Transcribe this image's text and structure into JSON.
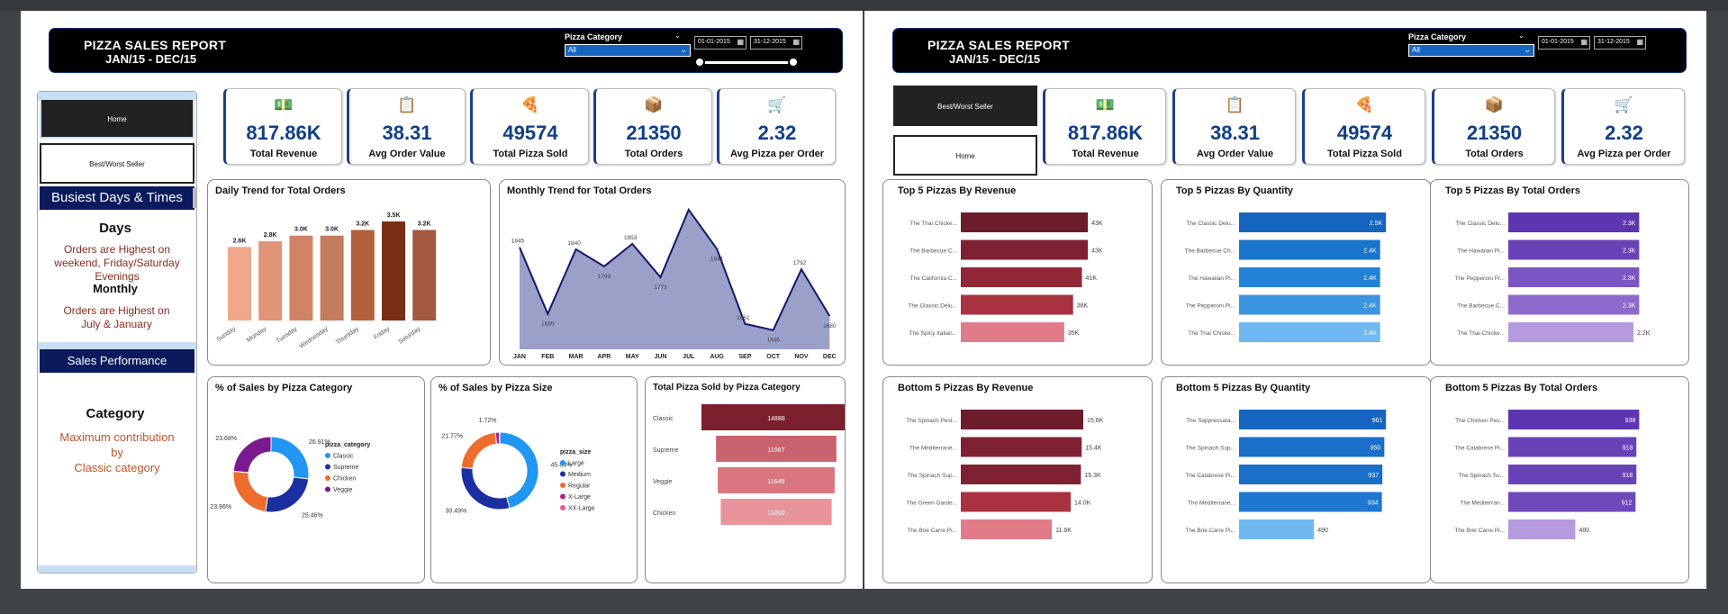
{
  "report": {
    "title": "PIZZA SALES REPORT",
    "subtitle": "JAN/15 - DEC/15"
  },
  "filters": {
    "category_label": "Pizza Category",
    "category_value": "All",
    "date_from": "01-01-2015",
    "date_to": "31-12-2015"
  },
  "nav": {
    "home": "Home",
    "best_worst": "Best/Worst Seller"
  },
  "kpis": [
    {
      "value": "817.86K",
      "label": "Total Revenue",
      "icon": "money-icon"
    },
    {
      "value": "38.31",
      "label": "Avg Order Value",
      "icon": "receipt-icon"
    },
    {
      "value": "49574",
      "label": "Total Pizza Sold",
      "icon": "pizza-icon"
    },
    {
      "value": "21350",
      "label": "Total Orders",
      "icon": "orders-icon"
    },
    {
      "value": "2.32",
      "label": "Avg Pizza per Order",
      "icon": "cart-icon"
    }
  ],
  "insights": {
    "busiest_title": "Busiest Days & Times",
    "days_head": "Days",
    "days_text": "Orders are Highest on weekend, Friday/Saturday Evenings",
    "monthly_head": "Monthly",
    "monthly_text": "Orders are Highest on July & January",
    "sales_perf": "Sales Performance",
    "category_head": "Category",
    "category_text_1": "Maximum contribution",
    "category_text_2": "by",
    "category_text_3": "Classic category"
  },
  "chart_titles": {
    "daily": "Daily Trend for Total Orders",
    "monthly": "Monthly Trend for Total Orders",
    "cat_pct": "% of Sales by Pizza Category",
    "size_pct": "% of Sales by Pizza Size",
    "cat_total": "Total Pizza Sold by Pizza Category",
    "top_rev": "Top 5 Pizzas By Revenue",
    "top_qty": "Top 5 Pizzas By Quantity",
    "top_ord": "Top 5 Pizzas By Total Orders",
    "bot_rev": "Bottom 5 Pizzas By Revenue",
    "bot_qty": "Bottom 5 Pizzas By Quantity",
    "bot_ord": "Bottom 5 Pizzas By Total Orders"
  },
  "chart_data": [
    {
      "id": "daily",
      "type": "bar",
      "categories": [
        "Sunday",
        "Monday",
        "Tuesday",
        "Wednesday",
        "Thursday",
        "Friday",
        "Saturday"
      ],
      "values": [
        2.6,
        2.8,
        3.0,
        3.0,
        3.2,
        3.5,
        3.2
      ],
      "labels": [
        "2.6K",
        "2.8K",
        "3.0K",
        "3.0K",
        "3.2K",
        "3.5K",
        "3.2K"
      ],
      "colors": [
        "#f0a88a",
        "#e09478",
        "#d08465",
        "#c57b5e",
        "#b3603f",
        "#7a2e16",
        "#a35a3e"
      ],
      "ylim": [
        0,
        3.5
      ]
    },
    {
      "id": "monthly",
      "type": "area",
      "categories": [
        "JAN",
        "FEB",
        "MAR",
        "APR",
        "MAY",
        "JUN",
        "JUL",
        "AUG",
        "SEP",
        "OCT",
        "NOV",
        "DEC"
      ],
      "values": [
        1845,
        1685,
        1840,
        1799,
        1853,
        1773,
        1935,
        1841,
        1661,
        1646,
        1792,
        1680
      ],
      "labels": [
        "1845",
        "1685",
        "1840",
        "1799",
        "1853",
        "1773",
        "",
        "1841",
        "1661",
        "1646",
        "1792",
        "1680"
      ],
      "ylim": [
        1600,
        1950
      ]
    },
    {
      "id": "cat_pct",
      "type": "pie",
      "legend_title": "pizza_category",
      "labels": [
        "Classic",
        "Supreme",
        "Chicken",
        "Veggie"
      ],
      "values": [
        26.91,
        25.46,
        23.96,
        23.68
      ],
      "pct": [
        "26.91%",
        "25.46%",
        "23.96%",
        "23.68%"
      ],
      "colors": [
        "#2196f3",
        "#1a2fa0",
        "#ef6c2f",
        "#7b1a8e"
      ]
    },
    {
      "id": "size_pct",
      "type": "pie",
      "legend_title": "pizza_size",
      "labels": [
        "Large",
        "Medium",
        "Regular",
        "X-Large",
        "XX-Large"
      ],
      "values": [
        45.89,
        30.49,
        21.77,
        1.72,
        0.12
      ],
      "pct": [
        "45.89%",
        "30.49%",
        "21.77%",
        "1.72%",
        ""
      ],
      "colors": [
        "#2196f3",
        "#1a2fa0",
        "#ef6c2f",
        "#b0208e",
        "#e85a8a"
      ]
    },
    {
      "id": "cat_total",
      "type": "bar",
      "categories": [
        "Classic",
        "Supreme",
        "Veggie",
        "Chicken"
      ],
      "values": [
        14888,
        11987,
        11649,
        11050
      ],
      "labels": [
        "14888",
        "11987",
        "11649",
        "11050"
      ],
      "colors": [
        "#7a1f2b",
        "#c9636d",
        "#d9767e",
        "#e8949a"
      ]
    },
    {
      "id": "top_rev",
      "type": "bar",
      "categories": [
        "The Thai Chicke...",
        "The Barbecue C...",
        "The California C...",
        "The Classic Delu...",
        "The Spicy Italian..."
      ],
      "values": [
        43,
        43,
        41,
        38,
        35
      ],
      "labels": [
        "43K",
        "43K",
        "41K",
        "38K",
        "35K"
      ],
      "colors": [
        "#6d1c2b",
        "#7e2233",
        "#912838",
        "#a8323f",
        "#e07b87"
      ],
      "label_inside": false
    },
    {
      "id": "top_qty",
      "type": "bar",
      "categories": [
        "The Classic Delu...",
        "The Barbecue Ch...",
        "The Hawaiian Pi...",
        "The Pepperoni Pi...",
        "The Thai Chicke..."
      ],
      "values": [
        2.5,
        2.4,
        2.4,
        2.4,
        2.4
      ],
      "labels": [
        "2.5K",
        "2.4K",
        "2.4K",
        "2.4K",
        "2.4K"
      ],
      "colors": [
        "#1565c0",
        "#1a73cc",
        "#2282d6",
        "#3b95e0",
        "#6fb8f2"
      ],
      "label_inside": true
    },
    {
      "id": "top_ord",
      "type": "bar",
      "categories": [
        "The Classic Delu...",
        "The Hawaiian Pi...",
        "The Pepperoni Pi...",
        "The Barbecue C...",
        "The Thai Chicke..."
      ],
      "values": [
        2.3,
        2.3,
        2.3,
        2.3,
        2.2
      ],
      "labels": [
        "2.3K",
        "2.3K",
        "2.3K",
        "2.3K",
        "2.2K"
      ],
      "colors": [
        "#5e35b1",
        "#6a42b8",
        "#7c55c2",
        "#8e6acc",
        "#b59ae0"
      ],
      "label_inside": true
    },
    {
      "id": "bot_rev",
      "type": "bar",
      "categories": [
        "The Spinach Pest...",
        "The Mediterrane...",
        "The Spinach Sup...",
        "The Green Garde...",
        "The Brie Carre Pi..."
      ],
      "values": [
        15.6,
        15.4,
        15.3,
        14.0,
        11.6
      ],
      "labels": [
        "15.6K",
        "15.4K",
        "15.3K",
        "14.0K",
        "11.6K"
      ],
      "colors": [
        "#6d1c2b",
        "#7e2233",
        "#7e2233",
        "#a8323f",
        "#e07b87"
      ],
      "label_inside": false
    },
    {
      "id": "bot_qty",
      "type": "bar",
      "categories": [
        "The Soppressata...",
        "The Spinach Sup...",
        "The Calabrese Pi...",
        "The Mediterrane...",
        "The Brie Carre Pi..."
      ],
      "values": [
        961,
        950,
        937,
        934,
        490
      ],
      "labels": [
        "961",
        "950",
        "937",
        "934",
        "490"
      ],
      "colors": [
        "#1565c0",
        "#1a6fc8",
        "#1a6fc8",
        "#1f78cf",
        "#6fb8f2"
      ],
      "label_inside": true
    },
    {
      "id": "bot_ord",
      "type": "bar",
      "categories": [
        "The Chicken Pes...",
        "The Calabrese Pi...",
        "The Spinach Su...",
        "The Mediterran...",
        "The Brie Carre Pi..."
      ],
      "values": [
        938,
        918,
        918,
        912,
        480
      ],
      "labels": [
        "938",
        "918",
        "918",
        "912",
        "480"
      ],
      "colors": [
        "#5e35b1",
        "#6a42b8",
        "#6a42b8",
        "#7048bc",
        "#b59ae0"
      ],
      "label_inside": true
    }
  ]
}
